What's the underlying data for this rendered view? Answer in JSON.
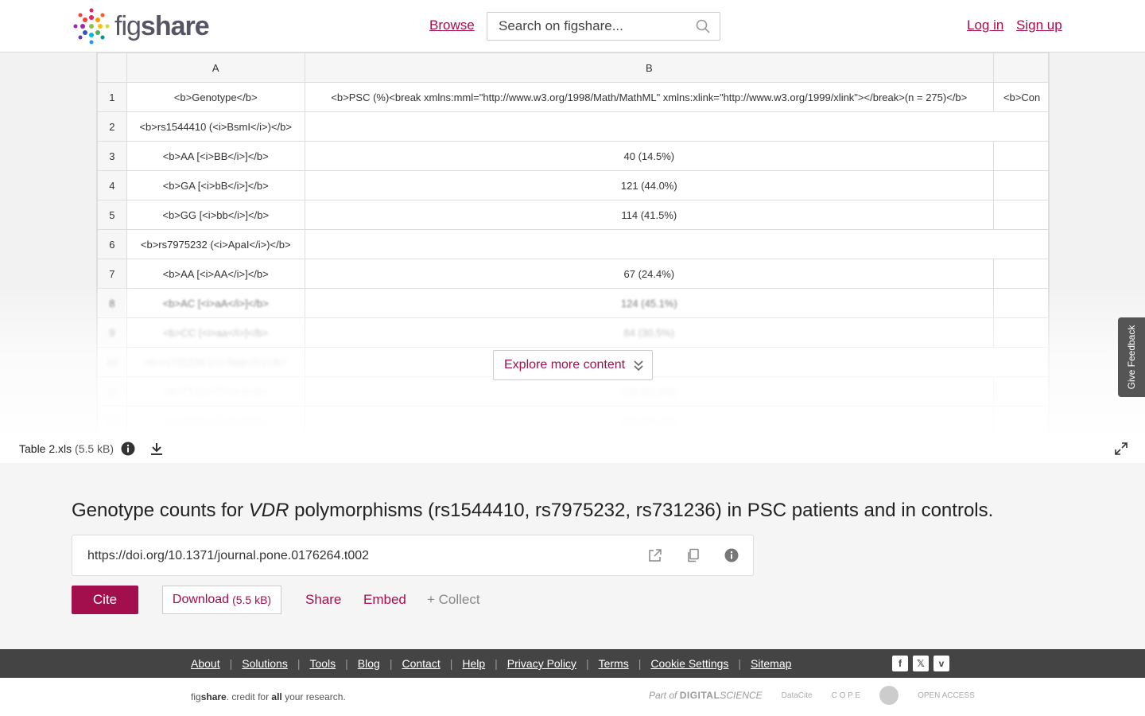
{
  "header": {
    "logo_text_light": "fig",
    "logo_text_bold": "share",
    "browse": "Browse",
    "search_placeholder": "Search on figshare...",
    "login": "Log in",
    "signup": "Sign up"
  },
  "sheet": {
    "columns": [
      "A",
      "B"
    ],
    "rows": [
      {
        "n": "1",
        "a": "<b>Genotype</b>",
        "b": "<b>PSC (%)<break xmlns:mml=\"http://www.w3.org/1998/Math/MathML\" xmlns:xlink=\"http://www.w3.org/1999/xlink\"></break>(n = 275)</b>",
        "c": "<b>Con"
      },
      {
        "n": "2",
        "a": "<b>rs1544410 (<i>BsmI</i>)</b>",
        "b": "",
        "c": ""
      },
      {
        "n": "3",
        "a": "<b>AA [<i>BB</i>]</b>",
        "b": "40 (14.5%)",
        "c": ""
      },
      {
        "n": "4",
        "a": "<b>GA [<i>bB</i>]</b>",
        "b": "121 (44.0%)",
        "c": ""
      },
      {
        "n": "5",
        "a": "<b>GG [<i>bb</i>]</b>",
        "b": "114 (41.5%)",
        "c": ""
      },
      {
        "n": "6",
        "a": "<b>rs7975232 (<i>ApaI</i>)</b>",
        "b": "",
        "c": ""
      },
      {
        "n": "7",
        "a": "<b>AA [<i>AA</i>]</b>",
        "b": "67 (24.4%)",
        "c": ""
      },
      {
        "n": "8",
        "a": "<b>AC [<i>aA</i>]</b>",
        "b": "124 (45.1%)",
        "c": ""
      },
      {
        "n": "9",
        "a": "<b>CC [<i>aa</i>]</b>",
        "b": "84 (30.5%)",
        "c": ""
      },
      {
        "n": "10",
        "a": "<b>rs731236 (<i>TaqI</i>)</b>",
        "b": "",
        "c": ""
      },
      {
        "n": "11",
        "a": "<b>TT [<i>TT</i>]</b>",
        "b": "115 (41.8%)",
        "c": ""
      },
      {
        "n": "12",
        "a": "<b>CT [<i>Tt</i>]</b>",
        "b": "124 (45.1%)",
        "c": ""
      }
    ],
    "explore_label": "Explore more content",
    "feedback_label": "Give Feedback"
  },
  "file": {
    "name": "Table 2.xls",
    "size": "(5.5 kB)"
  },
  "details": {
    "title_pre": "Genotype counts for ",
    "title_italic": "VDR",
    "title_post": " polymorphisms (rs1544410, rs7975232, rs731236) in PSC patients and in controls.",
    "doi": "https://doi.org/10.1371/journal.pone.0176264.t002",
    "cite": "Cite",
    "download": "Download",
    "download_size": "(5.5 kB)",
    "share": "Share",
    "embed": "Embed",
    "collect": "+ Collect"
  },
  "footer": {
    "links": [
      "About",
      "Solutions",
      "Tools",
      "Blog",
      "Contact",
      "Help",
      "Privacy Policy",
      "Terms",
      "Cookie Settings",
      "Sitemap"
    ],
    "credit_fig": "fig",
    "credit_share": "share",
    "credit_mid": ". credit for ",
    "credit_all": "all",
    "credit_end": " your research.",
    "partner_part_of": "Part of",
    "partner_ds": "DIGITAL",
    "partner_science": "SCIENCE",
    "partner_datacite": "DataCite",
    "partner_cope": "C O P E",
    "partner_open": "OPEN ACCESS"
  },
  "colors": {
    "accent": "#a30f4c",
    "footer_bg": "#444444",
    "details_bg": "#f5f5f5"
  }
}
